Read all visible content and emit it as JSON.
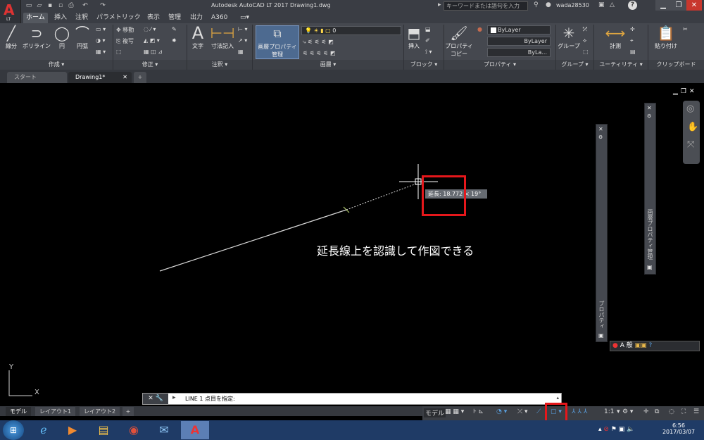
{
  "titlebar": {
    "app_logo": "A",
    "app_logo_sub": "LT",
    "title": "Autodesk AutoCAD LT 2017    Drawing1.dwg",
    "search_placeholder": "キーワードまたは語句を入力",
    "user": "wada28530",
    "help_label": "?"
  },
  "ribbon_tabs": [
    "ホーム",
    "挿入",
    "注釈",
    "パラメトリック",
    "表示",
    "管理",
    "出力",
    "A360"
  ],
  "ribbon": {
    "draw": {
      "title": "作成 ▾",
      "line": "線分",
      "polyline": "ポリライン",
      "circle": "円",
      "arc": "円弧"
    },
    "modify": {
      "title": "修正 ▾",
      "move": "移動",
      "copy": "複写"
    },
    "annotation": {
      "title": "注釈 ▾",
      "text": "文字",
      "dimension": "寸法記入"
    },
    "layers": {
      "title": "画層 ▾",
      "properties": "画層プロパティ管理",
      "current_layer": "0"
    },
    "block": {
      "title": "ブロック ▾",
      "insert": "挿入"
    },
    "properties": {
      "title": "プロパティ ▾",
      "copy": "プロパティコピー",
      "color": "ByLayer",
      "linetype": "ByLayer",
      "lineweight": "ByLa..."
    },
    "groups": {
      "title": "グループ ▾",
      "group": "グループ"
    },
    "utilities": {
      "title": "ユーティリティ ▾",
      "measure": "計測"
    },
    "clipboard": {
      "title": "クリップボード",
      "paste": "貼り付け"
    }
  },
  "doc_tabs": [
    {
      "label": "スタート"
    },
    {
      "label": "Drawing1*"
    }
  ],
  "canvas": {
    "tooltip": "延長: 18.772  < 19°",
    "annotation": "延長線上を認識して作図できる",
    "ucs_y": "Y",
    "ucs_x": "X",
    "palette_properties": "プロパティ",
    "palette_layers": "画層プロパティ管理",
    "ime_bar": "A 般"
  },
  "command_line": {
    "text": "LINE 1 点目を指定:"
  },
  "layout_tabs": [
    "モデル",
    "レイアウト1",
    "レイアウト2"
  ],
  "status": {
    "model": "モデル",
    "scale": "1:1"
  },
  "taskbar": {
    "time": "6:56",
    "date": "2017/03/07"
  },
  "colors": {
    "highlight": "#e5171b",
    "ribbon_bg": "#45484f",
    "canvas_bg": "#000000",
    "taskbar_bg": "#1f3b66"
  }
}
